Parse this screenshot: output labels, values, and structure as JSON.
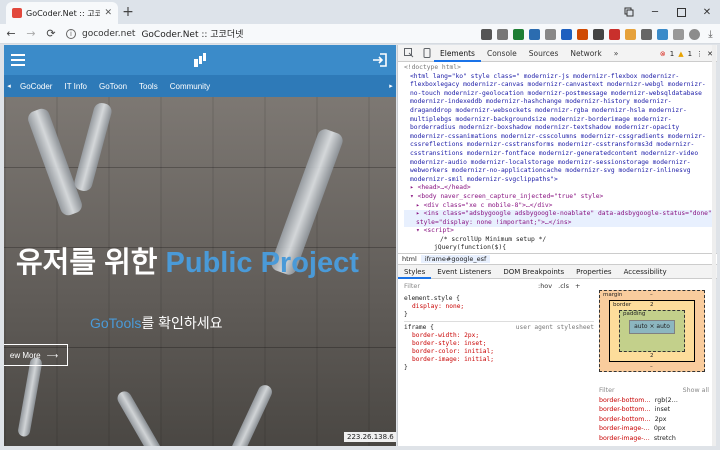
{
  "browser": {
    "tab_title": "GoCoder.Net :: 고코더",
    "tab_close": "✕",
    "new_tab": "+",
    "url": "gocoder.net",
    "page_title": "GoCoder.Net :: 고코더넷",
    "back": "←",
    "forward": "→",
    "reload": "⟳",
    "info": "i",
    "win_minimize": "─",
    "win_close": "✕"
  },
  "site": {
    "nav_prev": "◂",
    "nav_next": "▸",
    "nav": [
      "GoCoder",
      "IT Info",
      "GoToon",
      "Tools",
      "Community"
    ],
    "hero_title_main": "유저를 위한 ",
    "hero_title_accent": "Public Project",
    "hero_sub_accent": "GoTools",
    "hero_sub_rest": "를 확인하세요",
    "view_more": "ew More",
    "view_more_arrow": "⟶",
    "ip": "223.26.138.6",
    "colors": {
      "header": "#3b8bc9",
      "accent": "#4a9ad8"
    }
  },
  "devtools": {
    "tabs": [
      "Elements",
      "Console",
      "Sources",
      "Network"
    ],
    "more": "»",
    "errors": "1",
    "warnings": "1",
    "menu": "⋮",
    "close": "✕",
    "elements": {
      "doctype": "<!doctype html>",
      "html_tag": "<html lang=\"ko\" style class=\" modernizr-js modernizr-flexbox modernizr-flexboxlegacy modernizr-canvas modernizr-canvastext modernizr-webgl modernizr-no-touch modernizr-geolocation modernizr-postmessage modernizr-websqldatabase modernizr-indexeddb modernizr-hashchange modernizr-history modernizr-draganddrop modernizr-websockets modernizr-rgba modernizr-hsla modernizr-multiplebgs modernizr-backgroundsize modernizr-borderimage modernizr-borderradius modernizr-boxshadow modernizr-textshadow modernizr-opacity modernizr-cssanimations modernizr-csscolumns modernizr-cssgradients modernizr-cssreflections modernizr-csstransforms modernizr-csstransforms3d modernizr-csstransitions modernizr-fontface modernizr-generatedcontent modernizr-video modernizr-audio modernizr-localstorage modernizr-sessionstorage modernizr-webworkers modernizr-no-applicationcache modernizr-svg modernizr-inlinesvg modernizr-smil modernizr-svgclippaths\">",
      "head": "▸ <head>…</head>",
      "body": "▾ <body naver_screen_capture_injected=\"true\" style>",
      "div": "▸ <div class=\"xe c mobile-8\">…</div>",
      "ins": "▸ <ins class=\"adsbygoogle adsbygoogle-noablate\" data-adsbygoogle-status=\"done\" style=\"display: none !important;\">…</ins>",
      "script": "▾ <script>",
      "comment": "/* scrollUp Minimum setup */",
      "jquery": "jQuery(function($){"
    },
    "breadcrumbs": [
      "html",
      "iframe#google_esf"
    ],
    "style_tabs": [
      "Styles",
      "Event Listeners",
      "DOM Breakpoints",
      "Properties",
      "Accessibility"
    ],
    "filter_placeholder": "Filter",
    "filter_hov": ":hov",
    "filter_cls": ".cls",
    "filter_plus": "+",
    "rules": {
      "element_style": "element.style {",
      "element_prop": "display: none;",
      "close": "}",
      "iframe_sel": "iframe {",
      "iframe_src": "user agent stylesheet",
      "props": [
        "border-width: 2px;",
        "border-style: inset;",
        "border-color: initial;",
        "border-image: initial;"
      ]
    },
    "boxmodel": {
      "margin": "margin",
      "border": "border",
      "padding": "padding",
      "content": "auto × auto",
      "dash": "–",
      "border_val": "2"
    },
    "computed": {
      "filter": "Filter",
      "show_all": "Show all",
      "rows": [
        {
          "p": "border-bottom…",
          "v": "rgb(2…"
        },
        {
          "p": "border-bottom…",
          "v": "inset"
        },
        {
          "p": "border-bottom…",
          "v": "2px"
        },
        {
          "p": "border-image-…",
          "v": "0px"
        },
        {
          "p": "border-image-…",
          "v": "stretch"
        }
      ]
    }
  }
}
